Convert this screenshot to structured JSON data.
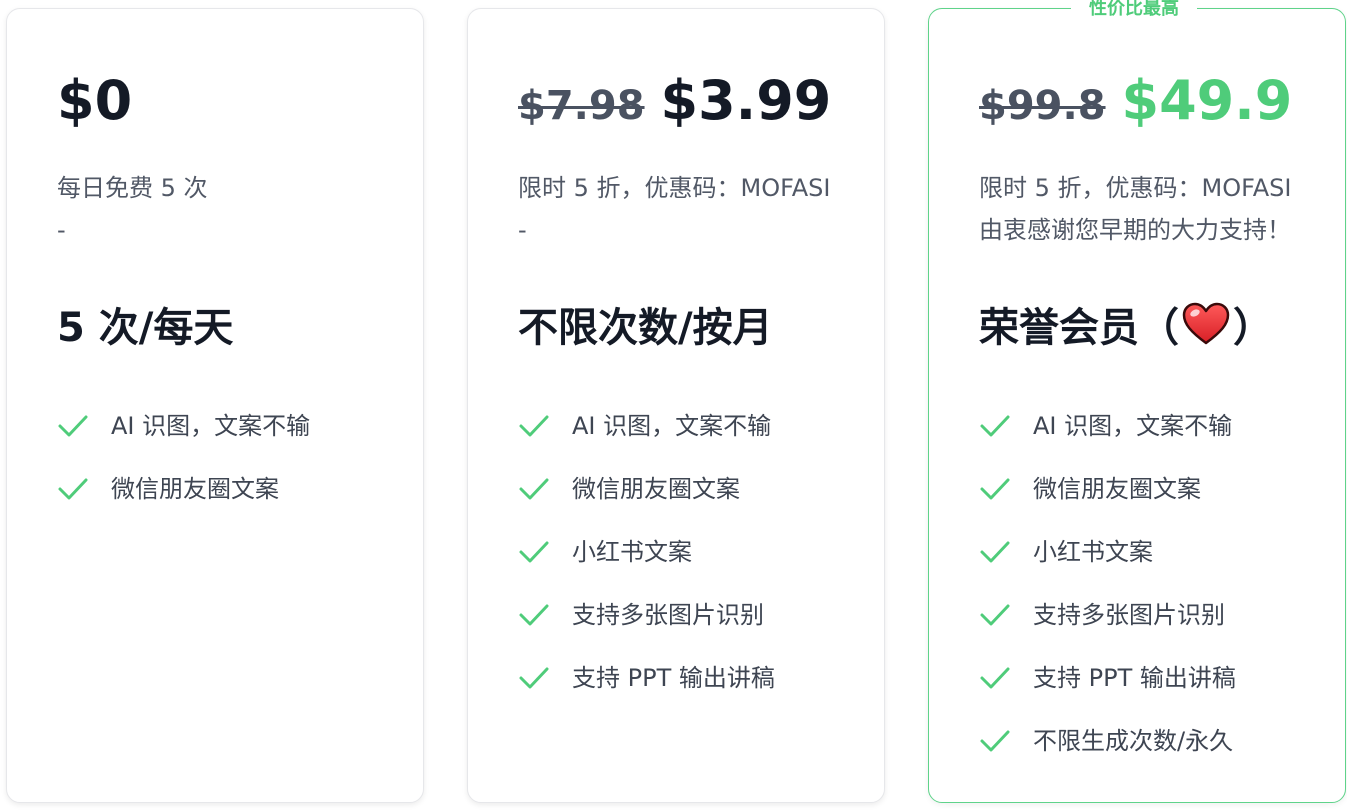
{
  "accent_color": "#4fcc7a",
  "plans": [
    {
      "price": "$0",
      "desc_line1": "每日免费 5 次",
      "desc_line2": "-",
      "title": "5 次/每天",
      "features": [
        "AI 识图，文案不输",
        "微信朋友圈文案"
      ]
    },
    {
      "old_price": "$7.98",
      "price": "$3.99",
      "desc_line1": "限时 5 折，优惠码：MOFASI",
      "desc_line2": "-",
      "title": "不限次数/按月",
      "features": [
        "AI 识图，文案不输",
        "微信朋友圈文案",
        "小红书文案",
        "支持多张图片识别",
        "支持 PPT 输出讲稿"
      ]
    },
    {
      "ribbon": "性价比最高",
      "old_price": "$99.8",
      "price": "$49.9",
      "desc_line1": "限时 5 折，优惠码：MOFASI",
      "desc_line2": "由衷感谢您早期的大力支持！",
      "title_prefix": "荣誉会员（",
      "title_suffix": "）",
      "title_icon": "heart-icon",
      "features": [
        "AI 识图，文案不输",
        "微信朋友圈文案",
        "小红书文案",
        "支持多张图片识别",
        "支持 PPT 输出讲稿",
        "不限生成次数/永久"
      ]
    }
  ]
}
